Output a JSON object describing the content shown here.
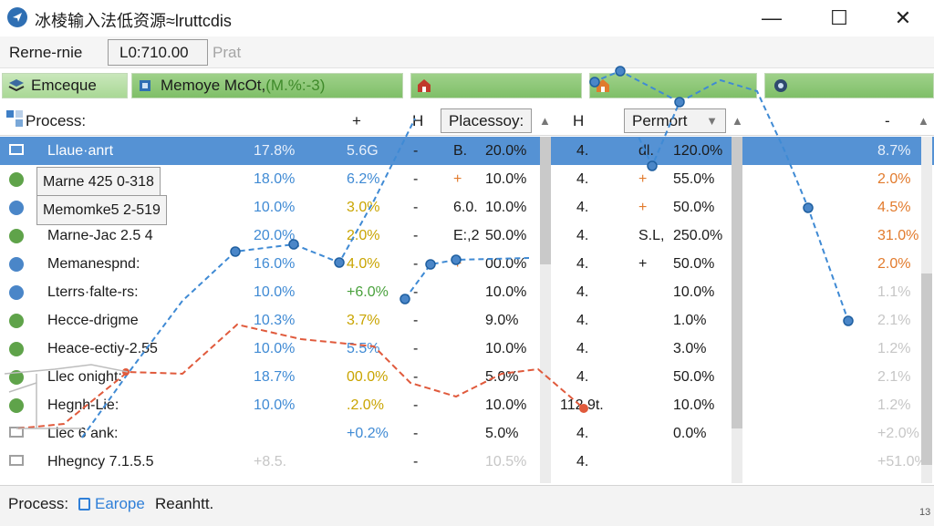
{
  "window": {
    "title": "冰棱输入法低资源≈lruttcdis",
    "minimize_glyph": "—",
    "maximize_glyph": "☐",
    "close_glyph": "✕"
  },
  "toolbar": {
    "label": "Rerne-rnie",
    "field_value": "L0:710.00",
    "field_placeholder": "Prat"
  },
  "tabs": [
    {
      "label": "Emceque",
      "icon": "stack-icon"
    },
    {
      "label": "Memoye McOt,",
      "extra": "(M.%:-3)",
      "icon": "chip-icon"
    },
    {
      "label": "",
      "icon": "house-icon"
    },
    {
      "label": "",
      "icon": "house-icon"
    },
    {
      "label": "",
      "icon": "gear-icon"
    }
  ],
  "columns": {
    "process": "Process:",
    "plus": "+",
    "h1": "H",
    "placessoy": "Placessoy:",
    "h2": "H",
    "permort": "Permort",
    "right": "-"
  },
  "rows": [
    {
      "name": "Llaue·anrt",
      "c1": "17.8%",
      "c2": "5.6G",
      "c3": "-",
      "c4a": "B.",
      "c4": "20.0%",
      "c5": "4.",
      "c6a": "dl.",
      "c6": "120.0%",
      "c7": "8.7%"
    },
    {
      "name": "Marne 425 0-318",
      "c1": "18.0%",
      "c2": "6.2%",
      "c3": "-",
      "c4a": "+",
      "c4": "10.0%",
      "c5": "4.",
      "c6a": "+",
      "c6": "55.0%",
      "c7": "2.0%"
    },
    {
      "name": "Memomke5 2-519",
      "c1": "10.0%",
      "c2": "3.0%",
      "c3": "-",
      "c4a": "6.0.",
      "c4": "10.0%",
      "c5": "4.",
      "c6a": "+",
      "c6": "50.0%",
      "c7": "4.5%"
    },
    {
      "name": "Marne-Jac 2.5 4",
      "c1": "20.0%",
      "c2": "2.0%",
      "c3": "-",
      "c4a": "E:,2",
      "c4": "50.0%",
      "c5": "4.",
      "c6a": "S.L,",
      "c6": "250.0%",
      "c7": "31.0%"
    },
    {
      "name": "Memanespnd:",
      "c1": "16.0%",
      "c2": "4.0%",
      "c3": "-",
      "c4a": "+",
      "c4": "00.0%",
      "c5": "4.",
      "c6a": "+",
      "c6": "50.0%",
      "c7": "2.0%"
    },
    {
      "name": "Lterrs·falte-rs:",
      "c1": "10.0%",
      "c2": "+6.0%",
      "c3": "-",
      "c4a": "",
      "c4": "10.0%",
      "c5": "4.",
      "c6a": "",
      "c6": "10.0%",
      "c7": "1.1%"
    },
    {
      "name": "Hecce-drigme",
      "c1": "10.3%",
      "c2": "3.7%",
      "c3": "-",
      "c4a": "",
      "c4": "9.0%",
      "c5": "4.",
      "c6a": "",
      "c6": "1.0%",
      "c7": "2.1%"
    },
    {
      "name": "Heace-ectiy-2.55",
      "c1": "10.0%",
      "c2": "5.5%",
      "c3": "-",
      "c4a": "",
      "c4": "10.0%",
      "c5": "4.",
      "c6a": "",
      "c6": "3.0%",
      "c7": "1.2%"
    },
    {
      "name": "Llec onight:",
      "c1": "18.7%",
      "c2": "00.0%",
      "c3": "-",
      "c4a": "",
      "c4": "5.0%",
      "c5": "4.",
      "c6a": "",
      "c6": "50.0%",
      "c7": "2.1%"
    },
    {
      "name": "Hegnh-Lie:",
      "c1": "10.0%",
      "c2": ".2.0%",
      "c3": "-",
      "c4a": "",
      "c4": "10.0%",
      "c5": "112.9t.",
      "c6a": "",
      "c6": "10.0%",
      "c7": "1.2%"
    },
    {
      "name": "Llec 6 ank:",
      "c1": "",
      "c2": "+0.2%",
      "c3": "-",
      "c4a": "",
      "c4": "5.0%",
      "c5": "4.",
      "c6a": "",
      "c6": "0.0%",
      "c7": "+2.0%"
    },
    {
      "name": "Hhegncy 7.1.5.5",
      "c1": "+8.5.",
      "c2": "",
      "c3": "-",
      "c4a": "",
      "c4": "10.5%",
      "c5": "4.",
      "c6a": "",
      "c6": "",
      "c7": "+51.0%"
    }
  ],
  "status": {
    "label": "Process:",
    "link": "Earope",
    "text": "Reanhtt.",
    "corner": "13"
  },
  "colors": {
    "accent_blue": "#4a86c8",
    "selection": "#5592d4",
    "tab_green": "#8ccb74",
    "line_blue": "#3f8ad4",
    "line_red": "#e05a3c"
  }
}
